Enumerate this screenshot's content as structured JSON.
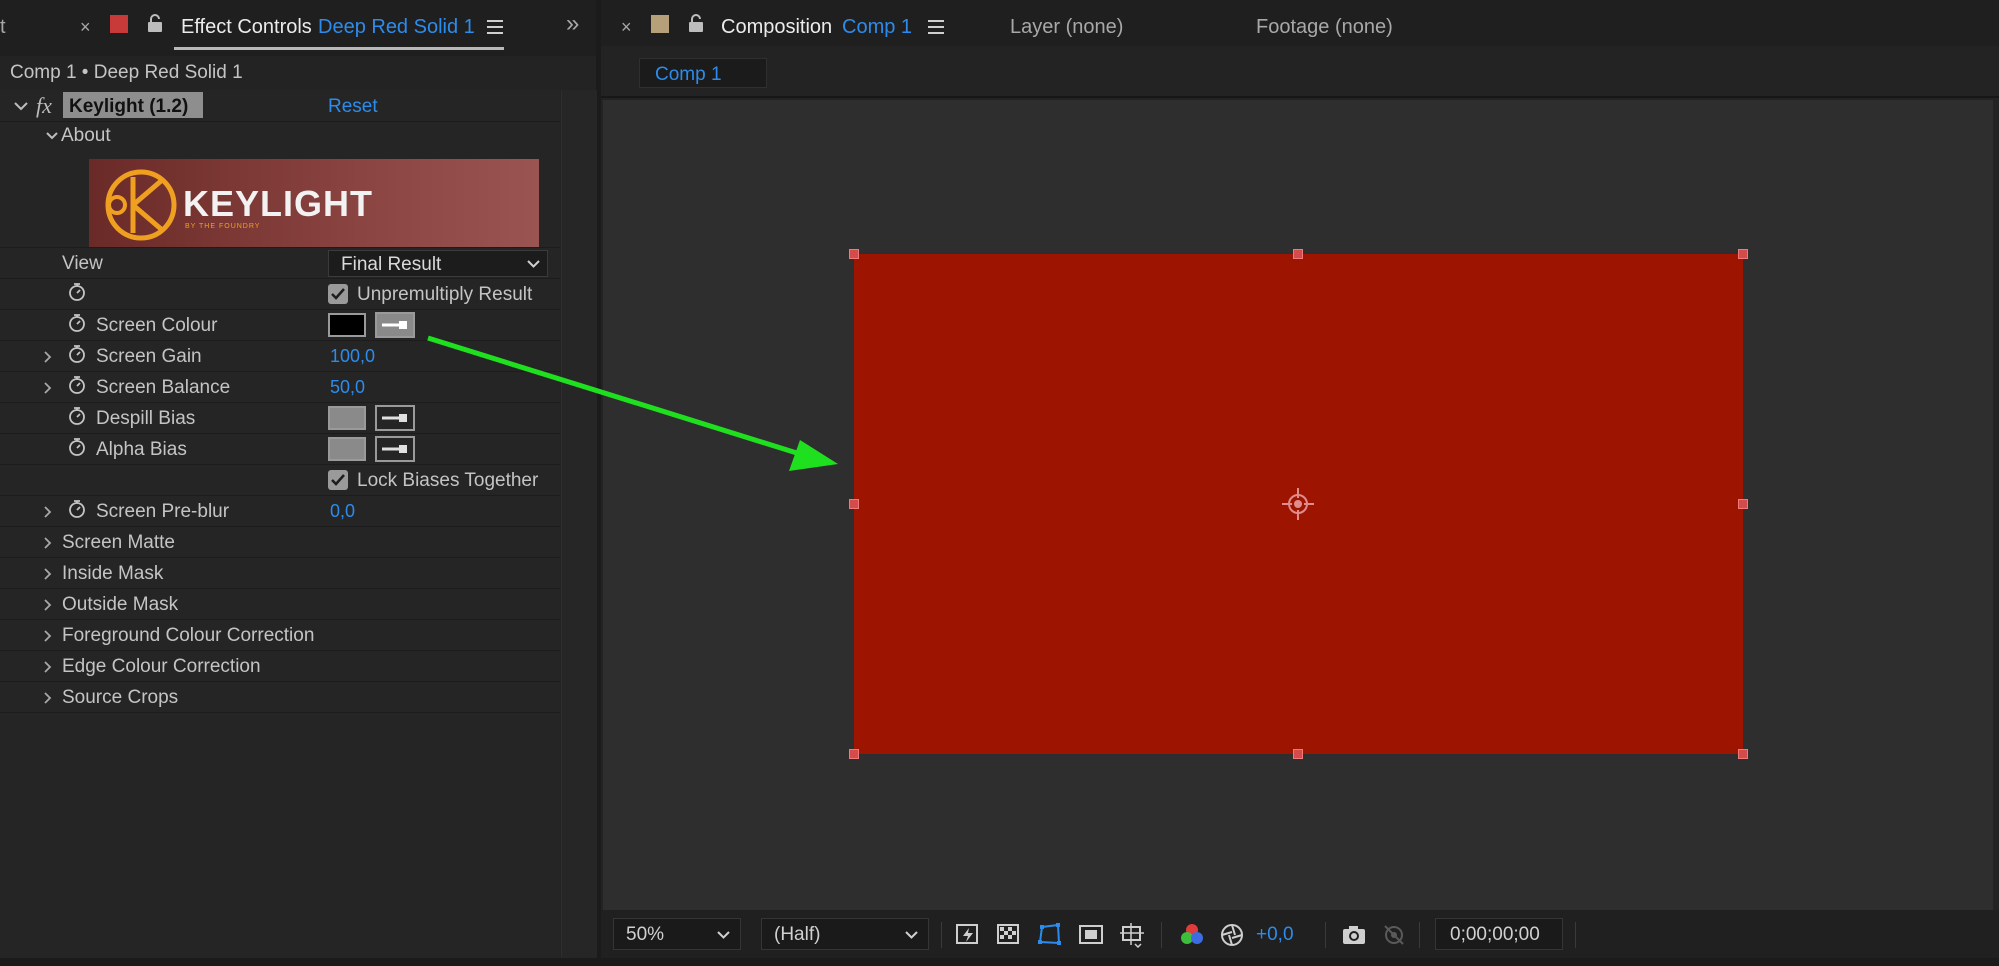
{
  "left_tabs": {
    "partial_tab_label": "t",
    "close_glyph": "×",
    "effect_controls_label": "Effect Controls",
    "effect_controls_target": "Deep Red Solid 1",
    "overflow_glyph": "»"
  },
  "breadcrumb": "Comp 1 • Deep Red Solid 1",
  "effect": {
    "fx_glyph": "fx",
    "name": "Keylight (1.2)",
    "reset_label": "Reset",
    "about_label": "About",
    "logo_text": "KEYLIGHT",
    "logo_subtext": "BY THE FOUNDRY",
    "view_label": "View",
    "view_value": "Final Result",
    "unpremultiply_label": "Unpremultiply Result",
    "screen_colour_label": "Screen Colour",
    "screen_gain_label": "Screen Gain",
    "screen_gain_value": "100,0",
    "screen_balance_label": "Screen Balance",
    "screen_balance_value": "50,0",
    "despill_bias_label": "Despill Bias",
    "alpha_bias_label": "Alpha Bias",
    "lock_biases_label": "Lock Biases Together",
    "screen_preblur_label": "Screen Pre-blur",
    "screen_preblur_value": "0,0",
    "groups": [
      "Screen Matte",
      "Inside Mask",
      "Outside Mask",
      "Foreground Colour Correction",
      "Edge Colour Correction",
      "Source Crops"
    ]
  },
  "right_tabs": {
    "close_glyph": "×",
    "composition_label": "Composition",
    "composition_target": "Comp 1",
    "layer_label": "Layer (none)",
    "footage_label": "Footage (none)",
    "comp_subtab": "Comp 1"
  },
  "viewer_controls": {
    "zoom": "50%",
    "resolution": "(Half)",
    "exposure": "+0,0",
    "timecode": "0;00;00;00"
  },
  "colors": {
    "solid_red": "#9d1500",
    "accent_blue": "#2d8ceb",
    "annotation_arrow": "#1fe01f",
    "label_color_red": "#c83a3a",
    "label_color_tan": "#b5a07a"
  },
  "icons": {
    "lock": "lock-icon",
    "menu": "hamburger-menu-icon",
    "stopwatch": "stopwatch-icon",
    "eyedropper": "eyedropper-icon",
    "snapshot": "camera-icon"
  }
}
